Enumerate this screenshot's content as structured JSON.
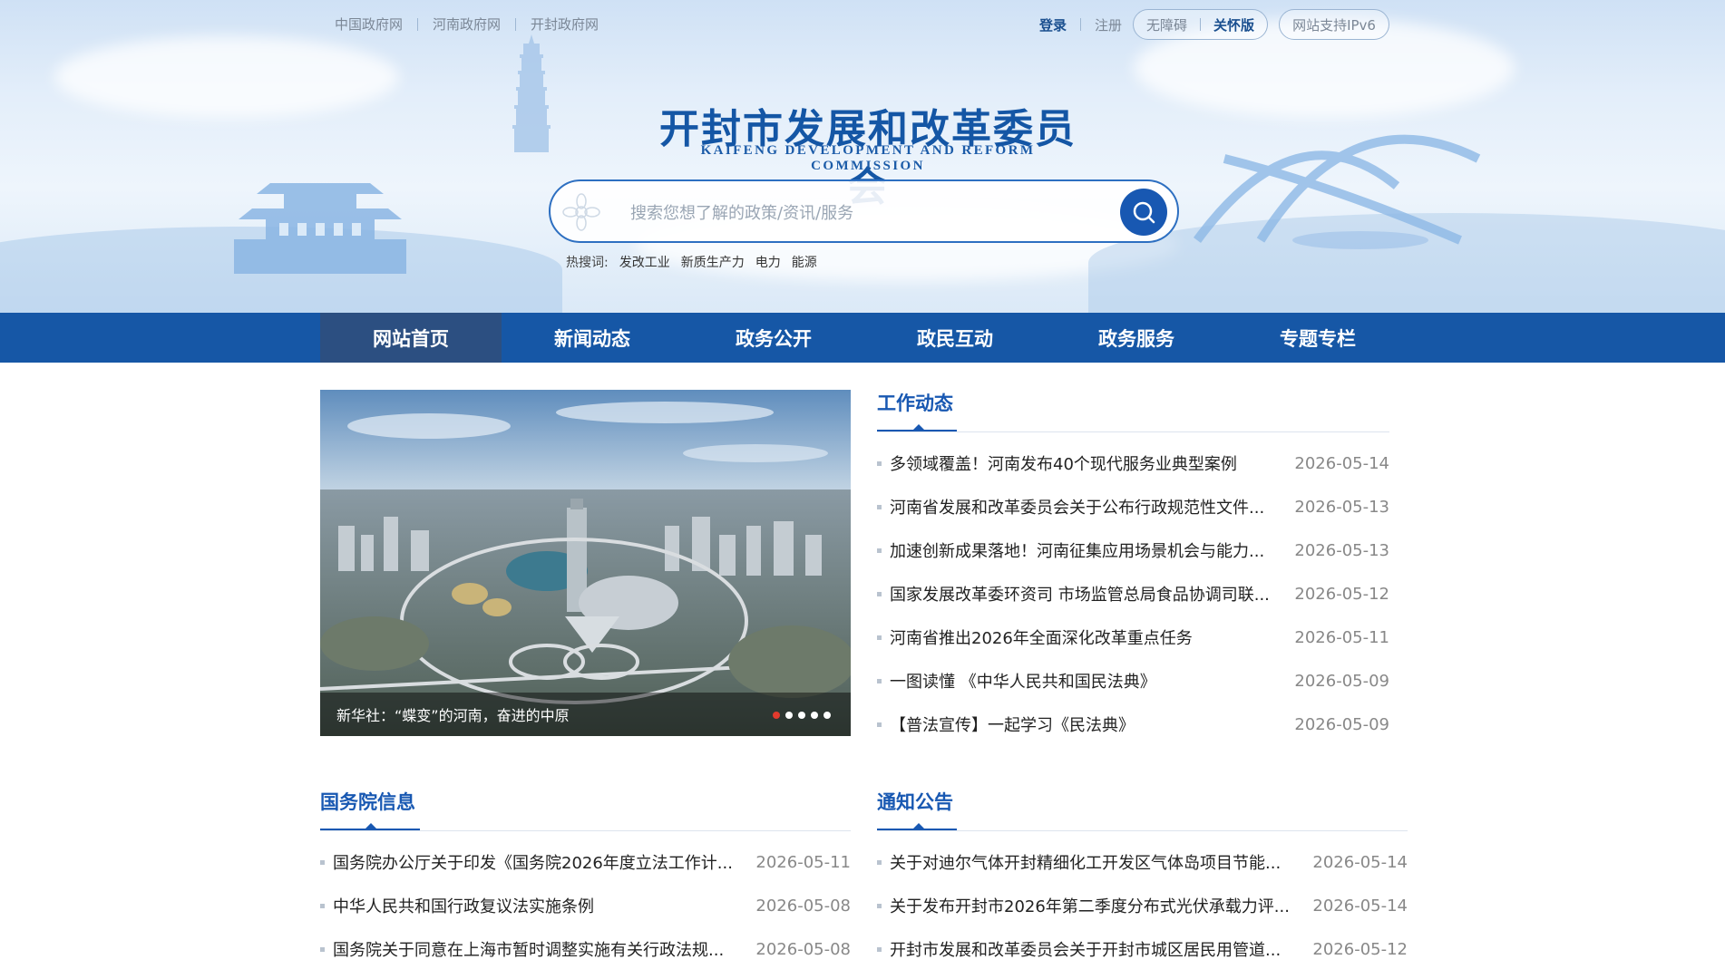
{
  "top_links": [
    "中国政府网",
    "河南政府网",
    "开封政府网"
  ],
  "account": {
    "login": "登录",
    "register": "注册"
  },
  "accessibility": {
    "barrier_free": "无障碍",
    "care_mode": "关怀版"
  },
  "ipv6_label": "网站支持IPv6",
  "site": {
    "title": "开封市发展和改革委员会",
    "subtitle": "KAIFENG DEVELOPMENT AND REFORM COMMISSION"
  },
  "search": {
    "placeholder": "搜索您想了解的政策/资讯/服务",
    "hot_label": "热搜词:",
    "hot_words": [
      "发改工业",
      "新质生产力",
      "电力",
      "能源"
    ]
  },
  "nav": [
    "网站首页",
    "新闻动态",
    "政务公开",
    "政民互动",
    "政务服务",
    "专题专栏"
  ],
  "carousel": {
    "caption": "新华社：“蝶变”的河南，奋进的中原",
    "active_slide": 1,
    "slide_count": 5
  },
  "work_news": {
    "title": "工作动态",
    "items": [
      {
        "title": "多领域覆盖！河南发布40个现代服务业典型案例",
        "date": "2026-05-14"
      },
      {
        "title": "河南省发展和改革委员会关于公布行政规范性文件...",
        "date": "2026-05-13"
      },
      {
        "title": "加速创新成果落地！河南征集应用场景机会与能力...",
        "date": "2026-05-13"
      },
      {
        "title": "国家发展改革委环资司 市场监管总局食品协调司联...",
        "date": "2026-05-12"
      },
      {
        "title": "河南省推出2026年全面深化改革重点任务",
        "date": "2026-05-11"
      },
      {
        "title": "一图读懂 《中华人民共和国民法典》",
        "date": "2026-05-09"
      },
      {
        "title": "【普法宣传】一起学习《民法典》",
        "date": "2026-05-09"
      }
    ]
  },
  "state_council": {
    "title": "国务院信息",
    "items": [
      {
        "title": "国务院办公厅关于印发《国务院2026年度立法工作计...",
        "date": "2026-05-11"
      },
      {
        "title": "中华人民共和国行政复议法实施条例",
        "date": "2026-05-08"
      },
      {
        "title": "国务院关于同意在上海市暂时调整实施有关行政法规...",
        "date": "2026-05-08"
      }
    ]
  },
  "notices": {
    "title": "通知公告",
    "items": [
      {
        "title": "关于对迪尔气体开封精细化工开发区气体岛项目节能...",
        "date": "2026-05-14"
      },
      {
        "title": "关于发布开封市2026年第二季度分布式光伏承载力评...",
        "date": "2026-05-14"
      },
      {
        "title": "开封市发展和改革委员会关于开封市城区居民用管道...",
        "date": "2026-05-12"
      }
    ]
  },
  "colors": {
    "brand_blue": "#1657a6",
    "nav_active": "#2c4f81",
    "title_blue": "#1858b2",
    "dot_active": "#e23a2d"
  }
}
